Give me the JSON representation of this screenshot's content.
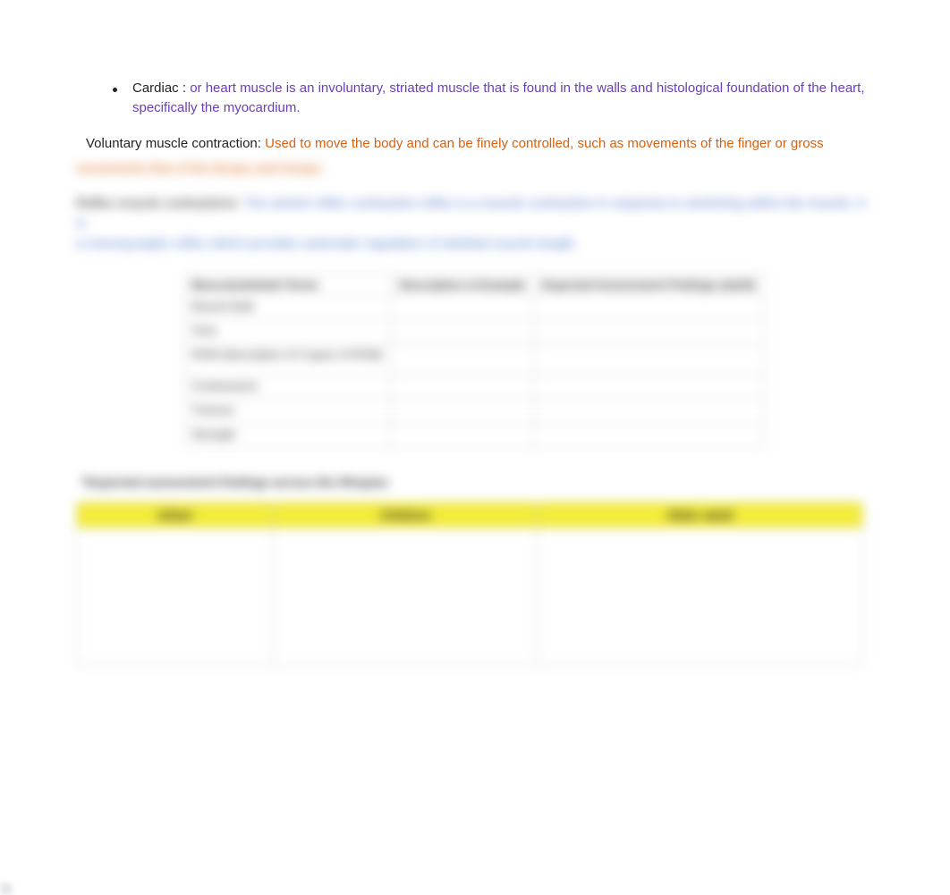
{
  "bullet": {
    "label": "Cardiac :  ",
    "text": "or heart muscle is an involuntary, striated muscle that is found in the walls and histological foundation of the heart, specifically the myocardium."
  },
  "voluntary": {
    "label": "Voluntary muscle contraction: ",
    "text_a": "Used to move the body and can be finely controlled, such as movements of the finger or gross ",
    "text_b": "movements that of the biceps and triceps."
  },
  "reflex": {
    "label": "Reflex muscle contractions: ",
    "text_a": "The stretch reflex contraction reflex is a muscle contraction in response to stretching within the muscle. It is ",
    "text_b": "a monosynaptic reflex which provides automatic regulation of skeletal muscle length."
  },
  "table1": {
    "headers": [
      "Musculoskeletal Terms",
      "Description & Example",
      "Expected Assessment Findings (adult)"
    ],
    "rows": [
      [
        "Muscle Bulk",
        "",
        ""
      ],
      [
        "Tone",
        "",
        ""
      ],
      [
        "ROM (description of 4 types of ROM)",
        "",
        ""
      ],
      [
        "Contractures",
        "",
        ""
      ],
      [
        "Tremors",
        "",
        ""
      ],
      [
        "Strength",
        "",
        ""
      ]
    ]
  },
  "midHeading": "*Expected assessment findings across the lifespan:",
  "table2": {
    "headers": [
      "Infant",
      "Children",
      "Older adult"
    ]
  }
}
